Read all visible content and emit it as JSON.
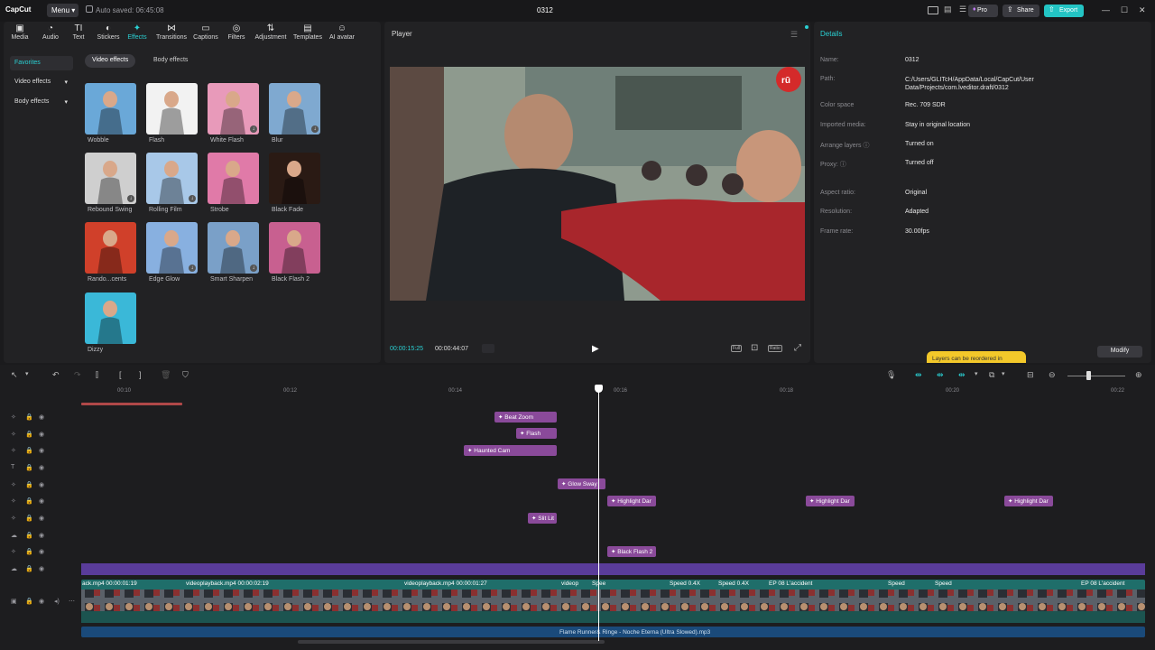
{
  "app": {
    "name": "CapCut",
    "menu": "Menu",
    "autosave": "Auto saved: 06:45:08",
    "project_title": "0312"
  },
  "topbar": {
    "pro": "Pro",
    "share": "Share",
    "export": "Export",
    "minimize": "—",
    "maximize": "☐",
    "close": "✕"
  },
  "toolbar": [
    {
      "label": "Media",
      "icon": "media-icon",
      "glyph": "▣"
    },
    {
      "label": "Audio",
      "icon": "audio-icon",
      "glyph": "◔"
    },
    {
      "label": "Text",
      "icon": "text-icon",
      "glyph": "TI"
    },
    {
      "label": "Stickers",
      "icon": "stickers-icon",
      "glyph": "◐"
    },
    {
      "label": "Effects",
      "icon": "effects-icon",
      "glyph": "✦"
    },
    {
      "label": "Transitions",
      "icon": "transitions-icon",
      "glyph": "⋈"
    },
    {
      "label": "Captions",
      "icon": "captions-icon",
      "glyph": "▭"
    },
    {
      "label": "Filters",
      "icon": "filters-icon",
      "glyph": "◎"
    },
    {
      "label": "Adjustment",
      "icon": "adjustment-icon",
      "glyph": "⇅"
    },
    {
      "label": "Templates",
      "icon": "templates-icon",
      "glyph": "▤"
    },
    {
      "label": "AI avatar",
      "icon": "ai-avatar-icon",
      "glyph": "☺"
    }
  ],
  "sidebar": {
    "favorites": "Favorites",
    "video_effects": "Video effects",
    "body_effects": "Body effects"
  },
  "effect_tabs": {
    "video": "Video effects",
    "body": "Body effects"
  },
  "effects": [
    {
      "name": "Wobble",
      "bg": "#6aa8d8",
      "dl": false
    },
    {
      "name": "Flash",
      "bg": "#f2f2f2",
      "dl": false
    },
    {
      "name": "White Flash",
      "bg": "#e89aba",
      "dl": true
    },
    {
      "name": "Blur",
      "bg": "#7fa9d0",
      "dl": true
    },
    {
      "name": "Rebound Swing",
      "bg": "#cfcfcf",
      "dl": true
    },
    {
      "name": "Rolling Film",
      "bg": "#a8c8e8",
      "dl": true
    },
    {
      "name": "Strobe",
      "bg": "#e07aa8",
      "dl": false
    },
    {
      "name": "Black Fade",
      "bg": "#2a1a14",
      "dl": false
    },
    {
      "name": "Rando...cents",
      "bg": "#d0402a",
      "dl": false
    },
    {
      "name": "Edge Glow",
      "bg": "#88b0e0",
      "dl": true
    },
    {
      "name": "Smart Sharpen",
      "bg": "#7aa0c8",
      "dl": true
    },
    {
      "name": "Black Flash 2",
      "bg": "#c86090",
      "dl": false
    },
    {
      "name": "Dizzy",
      "bg": "#3ab8d8",
      "dl": false
    }
  ],
  "player": {
    "title": "Player",
    "current": "00:00:15:25",
    "total": "00:00:44:07",
    "full": "Full",
    "ratio": "Ratio"
  },
  "details": {
    "title": "Details",
    "rows": [
      {
        "label": "Name:",
        "value": "0312"
      },
      {
        "label": "Path:",
        "value": "C:/Users/GLITcH/AppData/Local/CapCut/User Data/Projects/com.lveditor.draft/0312"
      },
      {
        "label": "Color space",
        "value": "Rec. 709 SDR"
      },
      {
        "label": "Imported media:",
        "value": "Stay in original location"
      },
      {
        "label": "Arrange layers ⓘ",
        "value": "Turned on"
      },
      {
        "label": "Proxy: ⓘ",
        "value": "Turned off"
      },
      {
        "label": "Aspect ratio:",
        "value": "Original"
      },
      {
        "label": "Resolution:",
        "value": "Adapted"
      },
      {
        "label": "Frame rate:",
        "value": "30.00fps"
      }
    ],
    "tooltip": "Layers can be reordered in",
    "modify": "Modify"
  },
  "ruler": [
    "00:10",
    "00:12",
    "00:14",
    "00:16",
    "00:18",
    "00:20",
    "00:22"
  ],
  "effect_clips": [
    "Beat Zoom",
    "Flash",
    "Haunted Cam",
    "Glow Sway",
    "Highlight Dar",
    "Highlight Dar",
    "Highlight Dar",
    "Slit Lit",
    "Black Flash 2"
  ],
  "video_clips": [
    "ack.mp4  00:00:01:19",
    "videoplayback.mp4  00:00:02:19",
    "videoplayback.mp4  00:00:01:27",
    "videop",
    "Spee",
    "Speed 0.4X",
    "Speed 0.4X",
    "EP 08 L'accident",
    "Speed",
    "Speed",
    "EP 08 L'accident"
  ],
  "audio": {
    "title": "Flame Runner& Ringe - Noche Eterna (Ultra Slowed).mp3"
  }
}
